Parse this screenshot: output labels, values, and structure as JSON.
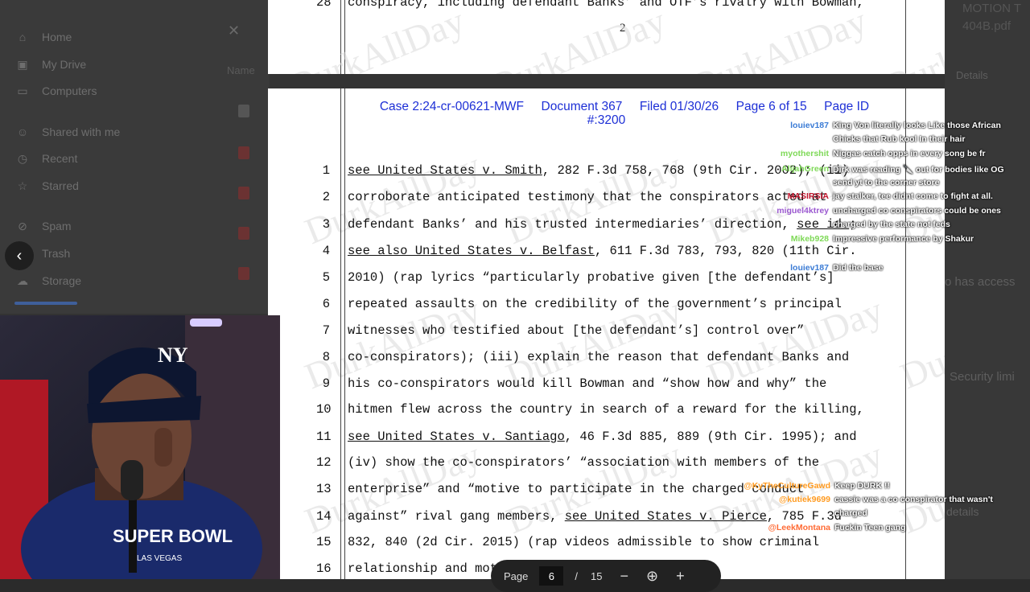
{
  "drive": {
    "nav": [
      "Home",
      "My Drive",
      "Computers",
      "Shared with me",
      "Recent",
      "Starred",
      "Spam",
      "Trash",
      "Storage"
    ],
    "names_header": "Name",
    "right_title": "MOTION T\n404B.pdf",
    "details_label": "Details",
    "right_texts": [
      "o has access",
      "Security limi",
      "details"
    ]
  },
  "pdf": {
    "prev_page_line": "conspiracy, including defendant Banks’ and OTF’s rivalry with Bowman,",
    "prev_page_line_no": "28",
    "prev_page_number": "2",
    "header_line1": "Case 2:24-cr-00621-MWF     Document 367     Filed 01/30/26     Page 6 of 15     Page ID",
    "header_line2": "#:3200",
    "watermark": "DurkAllDay",
    "lines": [
      {
        "n": "1",
        "parts": [
          {
            "t": "see United States v. Smith",
            "u": true
          },
          {
            "t": ", 282 F.3d 758, 768 (9th Cir. 2002); (ii)"
          }
        ]
      },
      {
        "n": "2",
        "parts": [
          {
            "t": "corroborate anticipated testimony that the conspirators acted at"
          }
        ]
      },
      {
        "n": "3",
        "parts": [
          {
            "t": "defendant Banks’ and his trusted intermediaries’ direction, "
          },
          {
            "t": "see id.",
            "u": true
          },
          {
            "t": ";"
          }
        ]
      },
      {
        "n": "4",
        "parts": [
          {
            "t": "see also United States v. Belfast",
            "u": true
          },
          {
            "t": ", 611 F.3d 783, 793, 820 (11th Cir."
          }
        ]
      },
      {
        "n": "5",
        "parts": [
          {
            "t": "2010) (rap lyrics “particularly probative given [the defendant’s]"
          }
        ]
      },
      {
        "n": "6",
        "parts": [
          {
            "t": "repeated assaults on the credibility of the government’s principal"
          }
        ]
      },
      {
        "n": "7",
        "parts": [
          {
            "t": "witnesses who testified about [the defendant’s] control over”"
          }
        ]
      },
      {
        "n": "8",
        "parts": [
          {
            "t": "co-conspirators); (iii) explain the reason that defendant Banks and"
          }
        ]
      },
      {
        "n": "9",
        "parts": [
          {
            "t": "his co-conspirators would kill Bowman and “show how and why” the"
          }
        ]
      },
      {
        "n": "10",
        "parts": [
          {
            "t": "hitmen flew across the country in search of a reward for the killing,"
          }
        ]
      },
      {
        "n": "11",
        "parts": [
          {
            "t": "see United States v. Santiago",
            "u": true
          },
          {
            "t": ", 46 F.3d 885, 889 (9th Cir. 1995); and"
          }
        ]
      },
      {
        "n": "12",
        "parts": [
          {
            "t": "(iv) show the co-conspirators’ “association with members of the"
          }
        ]
      },
      {
        "n": "13",
        "parts": [
          {
            "t": "enterprise” and “motive to participate in the charged conduct"
          }
        ]
      },
      {
        "n": "14",
        "parts": [
          {
            "t": "against” rival gang members, "
          },
          {
            "t": "see United States v. Pierce",
            "u": true
          },
          {
            "t": ", 785 F.3d"
          }
        ]
      },
      {
        "n": "15",
        "parts": [
          {
            "t": "832, 840 (2d Cir. 2015) (rap videos admissible to show criminal"
          }
        ]
      },
      {
        "n": "16",
        "parts": [
          {
            "t": "relationship and motive)."
          }
        ]
      }
    ]
  },
  "chat": [
    {
      "user": "louiev187",
      "color": "#3a7bd5",
      "msg": "King Von literally looks Like those African"
    },
    {
      "user": "",
      "color": "#ffffff",
      "msg": "Chicks that Rub kool In their hair"
    },
    {
      "user": "myothershit",
      "color": "#7ed957",
      "msg": "Niggas catch opps in every song be fr"
    },
    {
      "user": "AlijahGreen",
      "color": "#7ed957",
      "msg": "Dirk was reading 🔪 out for bodies like OG"
    },
    {
      "user": "",
      "color": "#ffffff",
      "msg": "send yt to the corner store"
    },
    {
      "user": "MASIRSIA",
      "color": "#c0132b",
      "msg": "jay stalker, tee didnt come to fight at all."
    },
    {
      "user": "miguel4ktrey",
      "color": "#9b59d0",
      "msg": "uncharged co conspirators could be ones"
    },
    {
      "user": "",
      "color": "#ffffff",
      "msg": "charged by the state not feds"
    },
    {
      "user": "Mikeb928",
      "color": "#7ed957",
      "msg": "Impressive performance by Shakur"
    },
    {
      "user": "louiev187",
      "color": "#3a7bd5",
      "msg": "Did the base"
    },
    {
      "user": "@KyTheCultureGawd",
      "color": "#ff9a1f",
      "msg": "Keep DURK !!"
    },
    {
      "user": "@kutiek9699",
      "color": "#ff9a1f",
      "msg": "cassie was a co conspirator that wasn't"
    },
    {
      "user": "",
      "color": "#ffffff",
      "msg": "charged"
    },
    {
      "user": "@LeekMontana",
      "color": "#ff6b35",
      "msg": "Fuckin Teen gang"
    }
  ],
  "toolbar": {
    "page_label": "Page",
    "page_value": "6",
    "separator": "/",
    "total_pages": "15",
    "zoom_out": "−",
    "zoom_in": "+"
  },
  "webcam": {
    "cap_text": "NY",
    "shirt_text": "SUPER BOWL",
    "shirt_sub": "LAS VEGAS"
  }
}
